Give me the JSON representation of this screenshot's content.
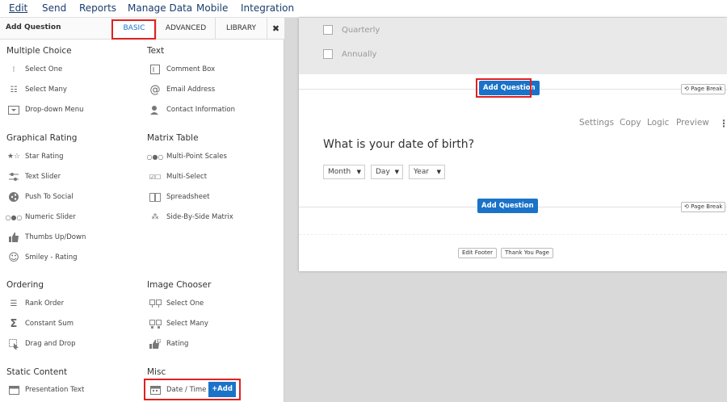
{
  "nav": {
    "items": [
      "Edit",
      "Send",
      "Reports",
      "Manage Data",
      "Mobile",
      "Integration"
    ]
  },
  "panel": {
    "title": "Add Question",
    "tabs": [
      "BASIC",
      "ADVANCED",
      "LIBRARY"
    ],
    "close": "✖"
  },
  "sections": {
    "multiple_choice": {
      "title": "Multiple Choice",
      "items": [
        "Select One",
        "Select Many",
        "Drop-down Menu"
      ]
    },
    "text": {
      "title": "Text",
      "items": [
        "Comment Box",
        "Email Address",
        "Contact Information"
      ]
    },
    "graphical_rating": {
      "title": "Graphical Rating",
      "items": [
        "Star Rating",
        "Text Slider",
        "Push To Social",
        "Numeric Slider",
        "Thumbs Up/Down",
        "Smiley - Rating"
      ]
    },
    "matrix_table": {
      "title": "Matrix Table",
      "items": [
        "Multi-Point Scales",
        "Multi-Select",
        "Spreadsheet",
        "Side-By-Side Matrix"
      ]
    },
    "ordering": {
      "title": "Ordering",
      "items": [
        "Rank Order",
        "Constant Sum",
        "Drag and Drop"
      ]
    },
    "image_chooser": {
      "title": "Image Chooser",
      "items": [
        "Select One",
        "Select Many",
        "Rating"
      ]
    },
    "static_content": {
      "title": "Static Content",
      "items": [
        "Presentation Text"
      ]
    },
    "misc": {
      "title": "Misc",
      "items": [
        "Date / Time"
      ],
      "add_label": "+Add"
    }
  },
  "canvas": {
    "options": [
      "Quarterly",
      "Annually"
    ],
    "add_question": "Add Question",
    "page_break": "Page Break",
    "tools": [
      "Settings",
      "Copy",
      "Logic",
      "Preview"
    ],
    "kebab": "⋮",
    "question": "What is your date of birth?",
    "selects": [
      "Month",
      "Day",
      "Year"
    ],
    "footer_buttons": [
      "Edit Footer",
      "Thank You Page"
    ]
  },
  "colors": {
    "accent": "#1a73c8",
    "highlight": "#e02020",
    "nav_text": "#1a3e6e"
  }
}
